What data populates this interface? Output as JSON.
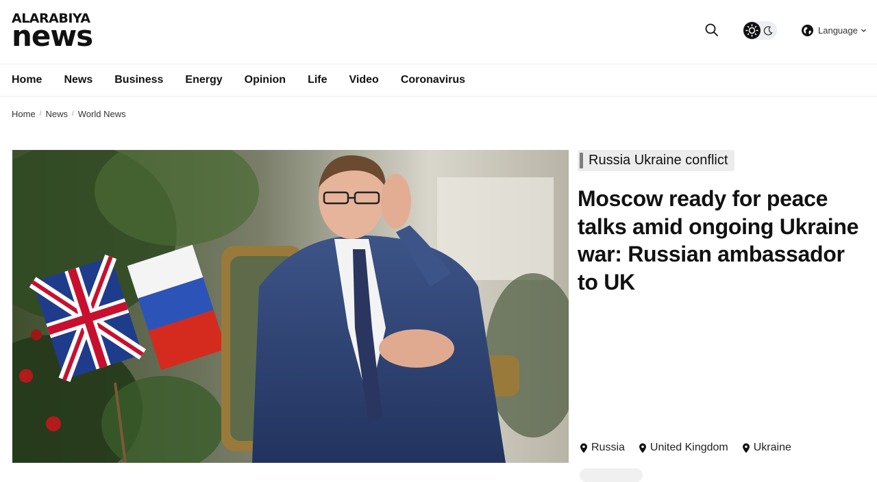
{
  "logo": {
    "top": "ALARABIYA",
    "bottom": "news"
  },
  "header": {
    "language_label": "Language"
  },
  "nav": {
    "items": [
      "Home",
      "News",
      "Business",
      "Energy",
      "Opinion",
      "Life",
      "Video",
      "Coronavirus"
    ]
  },
  "breadcrumb": {
    "items": [
      "Home",
      "News",
      "World News"
    ]
  },
  "article": {
    "category": "Russia Ukraine conflict",
    "headline": "Moscow ready for peace talks amid ongoing Ukraine war: Russian ambassador to UK",
    "locations": [
      "Russia",
      "United Kingdom",
      "Ukraine"
    ]
  },
  "icons": {
    "search": "search-icon",
    "theme_light": "sun-icon",
    "theme_dark": "moon-icon",
    "language": "globe-icon",
    "dropdown": "chevron-down-icon",
    "location": "map-pin-icon"
  },
  "colors": {
    "text": "#111111",
    "tag_bg": "#ececec",
    "tag_bar": "#7d7d7d",
    "divider": "#ececec"
  }
}
